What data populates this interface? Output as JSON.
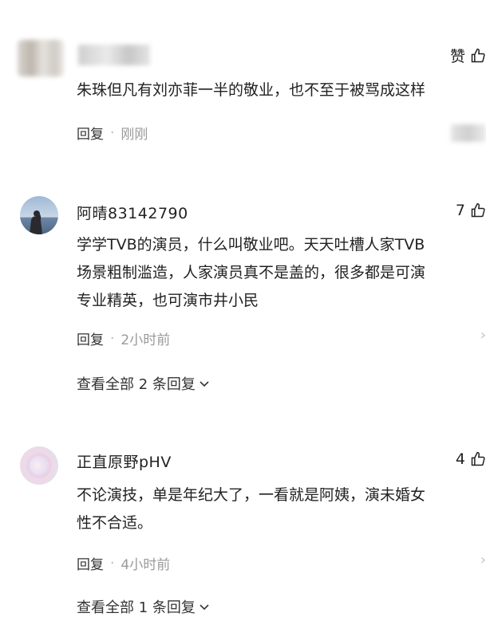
{
  "comments": [
    {
      "username": "",
      "likes": "赞",
      "lines": [
        "朱珠但凡有刘亦菲一半的敬业，也不至于被骂成这样"
      ],
      "reply_label": "回复",
      "dot": "·",
      "time": "刚刚"
    },
    {
      "username": "阿晴83142790",
      "likes": "7",
      "lines": [
        "学学TVB的演员，什么叫敬业吧。天天吐槽人家TVB",
        "场景粗制滥造，人家演员真不是盖的，很多都是可演",
        "专业精英，也可演市井小民"
      ],
      "reply_label": "回复",
      "dot": "·",
      "time": "2小时前",
      "view_replies": "查看全部 2 条回复"
    },
    {
      "username": "正直原野pHV",
      "likes": "4",
      "lines": [
        "不论演技，单是年纪大了，一看就是阿姨，演未婚女",
        "性不合适。"
      ],
      "reply_label": "回复",
      "dot": "·",
      "time": "4小时前",
      "view_replies": "查看全部 1 条回复"
    }
  ],
  "icons": {
    "like": "thumbs-up-icon",
    "chevron_down": "chevron-down-icon",
    "chevron_right": "chevron-right-icon"
  },
  "chevron_right_glyph": "›"
}
